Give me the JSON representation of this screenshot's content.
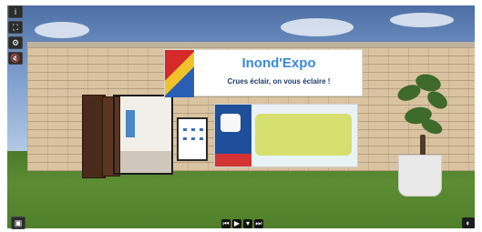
{
  "banner": {
    "title": "Inond'Expo",
    "subtitle": "Crues éclair, on vous éclaire !"
  },
  "toolbar": {
    "buttons": [
      {
        "name": "info",
        "glyph": "i"
      },
      {
        "name": "fullscreen",
        "glyph": "⛶"
      },
      {
        "name": "settings",
        "glyph": "⚙"
      },
      {
        "name": "mute",
        "glyph": "🔇"
      }
    ]
  },
  "bottom": {
    "left_icon": "▣",
    "right_icon": "◐",
    "media": {
      "prev": "⏮",
      "play": "▶",
      "menu": "▾",
      "next": "⏭"
    }
  },
  "colors": {
    "banner_title": "#3a8ad6",
    "banner_subtitle": "#1e3a6b",
    "grass": "#5c8c33",
    "brick": "#d9c3a1"
  }
}
